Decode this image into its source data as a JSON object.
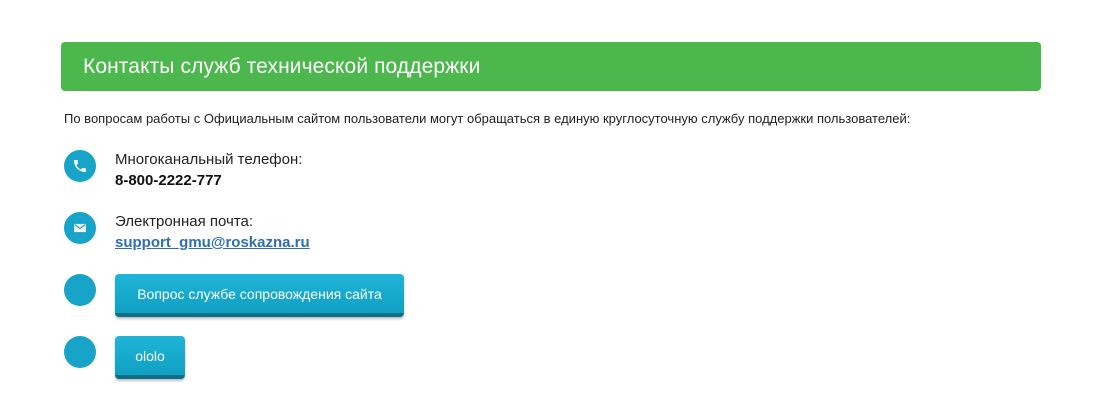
{
  "header": {
    "title": "Контакты служб технической поддержки"
  },
  "intro": {
    "text": "По вопросам работы с Официальным сайтом пользователи могут обращаться в единую круглосуточную службу поддержки пользователей:"
  },
  "contacts": {
    "phone": {
      "icon": "phone-icon",
      "label": "Многоканальный телефон:",
      "value": "8-800-2222-777"
    },
    "email": {
      "icon": "mail-icon",
      "label": "Электронная почта:",
      "value": "support_gmu@roskazna.ru"
    }
  },
  "buttons": {
    "support_question": "Вопрос службе сопровождения сайта",
    "ololo": "ololo"
  },
  "colors": {
    "header_bg": "#4cb74c",
    "accent": "#17a4c8",
    "link": "#2f6fb0"
  }
}
